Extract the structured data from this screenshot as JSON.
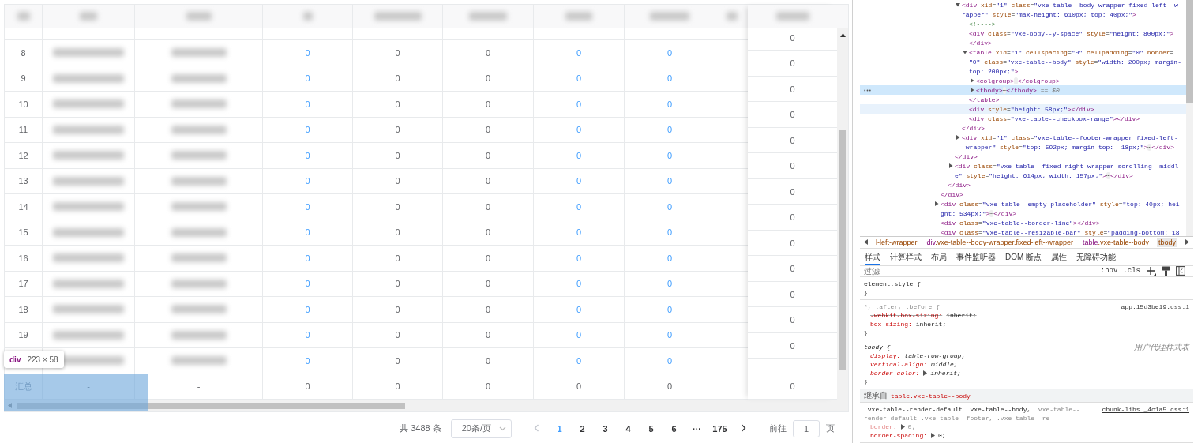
{
  "table": {
    "header": [
      {
        "kind": "blurred"
      },
      {
        "kind": "blurred"
      },
      {
        "kind": "blurred"
      },
      {
        "kind": "blurred"
      },
      {
        "kind": "blurred"
      },
      {
        "kind": "blurred"
      },
      {
        "kind": "blurred"
      },
      {
        "kind": "blurred"
      },
      {
        "kind": "blurred"
      }
    ],
    "rows": [
      {
        "index": "8",
        "cells": [
          {
            "kind": "blurred"
          },
          {
            "kind": "blurred"
          },
          {
            "kind": "link",
            "text": "0"
          },
          {
            "kind": "plain",
            "text": "0"
          },
          {
            "kind": "plain",
            "text": "0"
          },
          {
            "kind": "link",
            "text": "0"
          },
          {
            "kind": "link",
            "text": "0"
          }
        ]
      },
      {
        "index": "9",
        "cells": [
          {
            "kind": "blurred"
          },
          {
            "kind": "blurred"
          },
          {
            "kind": "link",
            "text": "0"
          },
          {
            "kind": "plain",
            "text": "0"
          },
          {
            "kind": "plain",
            "text": "0"
          },
          {
            "kind": "link",
            "text": "0"
          },
          {
            "kind": "link",
            "text": "0"
          }
        ]
      },
      {
        "index": "10",
        "cells": [
          {
            "kind": "blurred"
          },
          {
            "kind": "blurred"
          },
          {
            "kind": "link",
            "text": "0"
          },
          {
            "kind": "plain",
            "text": "0"
          },
          {
            "kind": "plain",
            "text": "0"
          },
          {
            "kind": "link",
            "text": "0"
          },
          {
            "kind": "link",
            "text": "0"
          }
        ]
      },
      {
        "index": "11",
        "cells": [
          {
            "kind": "blurred"
          },
          {
            "kind": "blurred"
          },
          {
            "kind": "link",
            "text": "0"
          },
          {
            "kind": "plain",
            "text": "0"
          },
          {
            "kind": "plain",
            "text": "0"
          },
          {
            "kind": "link",
            "text": "0"
          },
          {
            "kind": "link",
            "text": "0"
          }
        ]
      },
      {
        "index": "12",
        "cells": [
          {
            "kind": "blurred"
          },
          {
            "kind": "blurred"
          },
          {
            "kind": "link",
            "text": "0"
          },
          {
            "kind": "plain",
            "text": "0"
          },
          {
            "kind": "plain",
            "text": "0"
          },
          {
            "kind": "link",
            "text": "0"
          },
          {
            "kind": "link",
            "text": "0"
          }
        ]
      },
      {
        "index": "13",
        "cells": [
          {
            "kind": "blurred"
          },
          {
            "kind": "blurred"
          },
          {
            "kind": "link",
            "text": "0"
          },
          {
            "kind": "plain",
            "text": "0"
          },
          {
            "kind": "plain",
            "text": "0"
          },
          {
            "kind": "link",
            "text": "0"
          },
          {
            "kind": "link",
            "text": "0"
          }
        ]
      },
      {
        "index": "14",
        "cells": [
          {
            "kind": "blurred"
          },
          {
            "kind": "blurred"
          },
          {
            "kind": "link",
            "text": "0"
          },
          {
            "kind": "plain",
            "text": "0"
          },
          {
            "kind": "plain",
            "text": "0"
          },
          {
            "kind": "link",
            "text": "0"
          },
          {
            "kind": "link",
            "text": "0"
          }
        ]
      },
      {
        "index": "15",
        "cells": [
          {
            "kind": "blurred"
          },
          {
            "kind": "blurred"
          },
          {
            "kind": "link",
            "text": "0"
          },
          {
            "kind": "plain",
            "text": "0"
          },
          {
            "kind": "plain",
            "text": "0"
          },
          {
            "kind": "link",
            "text": "0"
          },
          {
            "kind": "link",
            "text": "0"
          }
        ]
      },
      {
        "index": "16",
        "cells": [
          {
            "kind": "blurred"
          },
          {
            "kind": "blurred"
          },
          {
            "kind": "link",
            "text": "0"
          },
          {
            "kind": "plain",
            "text": "0"
          },
          {
            "kind": "plain",
            "text": "0"
          },
          {
            "kind": "link",
            "text": "0"
          },
          {
            "kind": "link",
            "text": "0"
          }
        ]
      },
      {
        "index": "17",
        "cells": [
          {
            "kind": "blurred"
          },
          {
            "kind": "blurred"
          },
          {
            "kind": "link",
            "text": "0"
          },
          {
            "kind": "plain",
            "text": "0"
          },
          {
            "kind": "plain",
            "text": "0"
          },
          {
            "kind": "link",
            "text": "0"
          },
          {
            "kind": "link",
            "text": "0"
          }
        ]
      },
      {
        "index": "18",
        "cells": [
          {
            "kind": "blurred"
          },
          {
            "kind": "blurred"
          },
          {
            "kind": "link",
            "text": "0"
          },
          {
            "kind": "plain",
            "text": "0"
          },
          {
            "kind": "plain",
            "text": "0"
          },
          {
            "kind": "link",
            "text": "0"
          },
          {
            "kind": "link",
            "text": "0"
          }
        ]
      },
      {
        "index": "19",
        "cells": [
          {
            "kind": "blurred"
          },
          {
            "kind": "blurred"
          },
          {
            "kind": "link",
            "text": "0"
          },
          {
            "kind": "plain",
            "text": "0"
          },
          {
            "kind": "plain",
            "text": "0"
          },
          {
            "kind": "link",
            "text": "0"
          },
          {
            "kind": "link",
            "text": "0"
          }
        ]
      },
      {
        "cells": [
          {
            "kind": "blurred"
          },
          {
            "kind": "blurred"
          },
          {
            "kind": "link",
            "text": "0"
          },
          {
            "kind": "plain",
            "text": "0"
          },
          {
            "kind": "plain",
            "text": "0"
          },
          {
            "kind": "link",
            "text": "0"
          },
          {
            "kind": "link",
            "text": "0"
          }
        ]
      }
    ],
    "summary": {
      "label": "汇总",
      "cells": [
        {
          "kind": "plain",
          "text": "-"
        },
        {
          "kind": "plain",
          "text": "-"
        },
        {
          "kind": "plain",
          "text": "0"
        },
        {
          "kind": "plain",
          "text": "0"
        },
        {
          "kind": "plain",
          "text": "0"
        },
        {
          "kind": "plain",
          "text": "0"
        },
        {
          "kind": "plain",
          "text": "0"
        }
      ]
    },
    "fixed_column": {
      "header": {
        "kind": "blurred"
      },
      "values": [
        "0",
        "0",
        "0",
        "0",
        "0",
        "0",
        "0",
        "0",
        "0",
        "0",
        "0",
        "0",
        "0"
      ],
      "summary": "0"
    }
  },
  "inspect_tooltip": {
    "tag": "div",
    "size": "223 × 58"
  },
  "pagination": {
    "total": "共 3488 条",
    "page_size": "20条/页",
    "prev_disabled": true,
    "pages": [
      {
        "label": "1",
        "selected": true
      },
      {
        "label": "2",
        "selected": false
      },
      {
        "label": "3",
        "selected": false
      },
      {
        "label": "4",
        "selected": false
      },
      {
        "label": "5",
        "selected": false
      },
      {
        "label": "6",
        "selected": false
      }
    ],
    "more": "···",
    "last_page": "175",
    "goto_label": "前往",
    "goto_value": "1",
    "goto_suffix": "页"
  },
  "devtools": {
    "tree": [
      {
        "close": "</div>",
        "selected": false,
        "hovered": false,
        "children": [
          {
            "close": "</div>",
            "selected": false,
            "hovered": false,
            "children": [
              {
                "close": "</div>",
                "selected": false,
                "hovered": false,
                "children": [
                  {
                    "expanded": true,
                    "selected": false,
                    "hovered": false,
                    "lines": [
                      "<div xid=\"1\" class=\"vxe-table--body-wrapper fixed-left--w",
                      "rapper\" style=\"max-height: 610px; top: 40px;\">"
                    ],
                    "close": "</div>",
                    "children": [
                      {
                        "selected": false,
                        "hovered": false,
                        "lines": [
                          "<!---->"
                        ]
                      },
                      {
                        "selected": false,
                        "hovered": false,
                        "lines": [
                          "<div class=\"vxe-body--y-space\" style=\"height: 800px;\">"
                        ],
                        "close": "</div>"
                      },
                      {
                        "expanded": true,
                        "selected": false,
                        "hovered": false,
                        "lines": [
                          "<table xid=\"1\" cellspacing=\"0\" cellpadding=\"0\" border=",
                          "\"0\" class=\"vxe-table--body\" style=\"width: 200px; margin-",
                          "top: 200px;\">"
                        ],
                        "close": "</table>",
                        "children": [
                          {
                            "expanded": false,
                            "selected": false,
                            "hovered": false,
                            "lines": [
                              "<colgroup>⋯</colgroup>"
                            ]
                          },
                          {
                            "expanded": false,
                            "selected": true,
                            "hovered": false,
                            "lines": [
                              "<tbody>⋯</tbody> == $0"
                            ]
                          }
                        ]
                      },
                      {
                        "selected": false,
                        "hovered": true,
                        "lines": [
                          "<div style=\"height: 58px;\"></div>"
                        ]
                      },
                      {
                        "selected": false,
                        "hovered": false,
                        "lines": [
                          "<div class=\"vxe-table--checkbox-range\"></div>"
                        ]
                      }
                    ]
                  },
                  {
                    "expanded": false,
                    "selected": false,
                    "hovered": false,
                    "lines": [
                      "<div xid=\"1\" class=\"vxe-table--footer-wrapper fixed-left-",
                      "-wrapper\" style=\"top: 592px; margin-top: -18px;\">⋯</div>"
                    ]
                  }
                ]
              },
              {
                "expanded": false,
                "selected": false,
                "hovered": false,
                "lines": [
                  "<div class=\"vxe-table--fixed-right-wrapper scrolling--middl",
                  "e\" style=\"height: 614px; width: 157px;\">⋯</div>"
                ]
              }
            ]
          }
        ]
      },
      {
        "expanded": false,
        "selected": false,
        "hovered": false,
        "lines": [
          "<div class=\"vxe-table--empty-placeholder\" style=\"top: 40px; hei",
          "ght: 534px;\">⋯</div>"
        ]
      },
      {
        "selected": false,
        "hovered": false,
        "lines": [
          "<div class=\"vxe-table--border-line\"></div>"
        ]
      },
      {
        "selected": false,
        "hovered": false,
        "lines": [
          "<div class=\"vxe-table--resizable-bar\" style=\"padding-bottom: 18"
        ]
      }
    ],
    "breadcrumbs": [
      {
        "label": "l-left-wrapper",
        "selected": false
      },
      {
        "label": "div.vxe-table--body-wrapper.fixed-left--wrapper",
        "selected": false
      },
      {
        "label": "table.vxe-table--body",
        "selected": false
      },
      {
        "label": "tbody",
        "selected": true
      }
    ],
    "tabs": [
      {
        "label": "样式",
        "selected": true
      },
      {
        "label": "计算样式",
        "selected": false
      },
      {
        "label": "布局",
        "selected": false
      },
      {
        "label": "事件监听器",
        "selected": false
      },
      {
        "label": "DOM 断点",
        "selected": false
      },
      {
        "label": "属性",
        "selected": false
      },
      {
        "label": "无障碍功能",
        "selected": false
      }
    ],
    "filter": {
      "placeholder": "过滤"
    },
    "filter_buttons": [
      ":hov",
      ".cls"
    ],
    "rules": [
      {
        "kind": "rule",
        "selector": [
          [
            {
              "text": "element.style {",
              "matched": true
            }
          ]
        ],
        "close": "}"
      },
      {
        "kind": "rule",
        "selector": [
          [
            {
              "text": "*, :after, :before {",
              "matched": false
            }
          ]
        ],
        "source": "app.15d3be19.css:1",
        "props": [
          {
            "name": "-webkit-box-sizing:",
            "value": "inherit;",
            "struck": true,
            "inactive": false,
            "expandable": false
          },
          {
            "name": "box-sizing:",
            "value": "inherit;",
            "struck": false,
            "inactive": false,
            "expandable": false
          }
        ],
        "close": "}"
      },
      {
        "kind": "rule",
        "user_agent": true,
        "selector": [
          [
            {
              "text": "tbody {",
              "matched": true
            }
          ]
        ],
        "source": "用户代理样式表",
        "props": [
          {
            "name": "display:",
            "value": "table-row-group;",
            "struck": false,
            "inactive": false,
            "expandable": false
          },
          {
            "name": "vertical-align:",
            "value": "middle;",
            "struck": false,
            "inactive": false,
            "expandable": false
          },
          {
            "name": "border-color:",
            "value": "inherit;",
            "struck": false,
            "inactive": false,
            "expandable": true
          }
        ],
        "close": "}"
      },
      {
        "kind": "inherited",
        "label": "继承自",
        "from": "table.vxe-table--body"
      },
      {
        "kind": "rule",
        "selector": [
          [
            {
              "text": ".vxe-table--render-default .vxe-table--body,",
              "matched": true
            },
            {
              "text": " .vxe-table--",
              "matched": false
            }
          ],
          [
            {
              "text": "render-default .vxe-table--footer, .vxe-table--re",
              "matched": false
            }
          ]
        ],
        "source": "chunk-libs._4c1a5.css:1",
        "props": [
          {
            "name": "border:",
            "value": "0;",
            "struck": false,
            "inactive": true,
            "expandable": true
          },
          {
            "name": "border-spacing:",
            "value": "0;",
            "struck": false,
            "inactive": false,
            "expandable": true
          }
        ]
      }
    ]
  }
}
